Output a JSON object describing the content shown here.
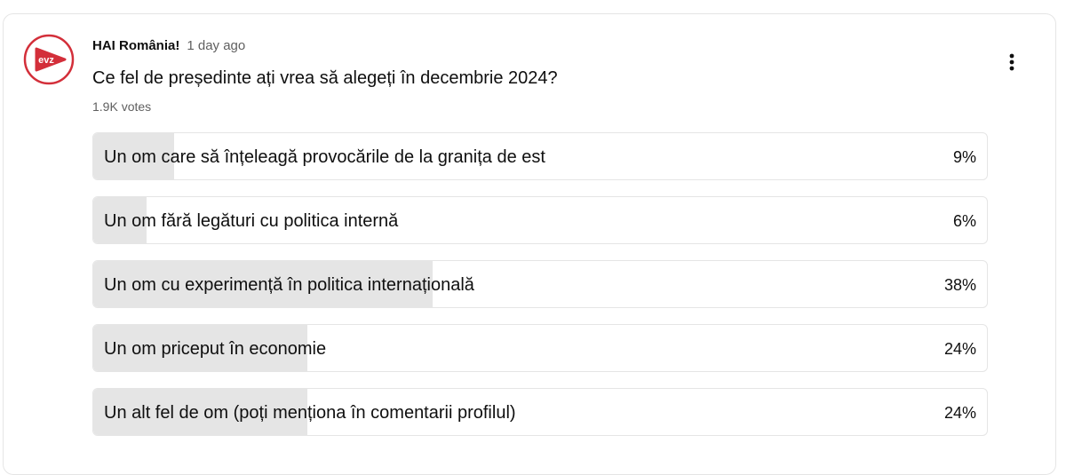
{
  "post": {
    "channel": "HAI România!",
    "time": "1 day ago",
    "question": "Ce fel de președinte ați vrea să alegeți în decembrie 2024?",
    "votes": "1.9K votes",
    "avatar_text": "evz"
  },
  "accent_color": "#d32f3a",
  "poll_options": [
    {
      "label": "Un om care să înțeleagă provocările de la granița de est",
      "percent": "9%",
      "value": 9
    },
    {
      "label": "Un om fără legături cu politica internă",
      "percent": "6%",
      "value": 6
    },
    {
      "label": "Un om cu experimență în politica internațională",
      "percent": "38%",
      "value": 38
    },
    {
      "label": "Un om priceput în economie",
      "percent": "24%",
      "value": 24
    },
    {
      "label": "Un alt fel de om (poți menționa în comentarii profilul)",
      "percent": "24%",
      "value": 24
    }
  ]
}
